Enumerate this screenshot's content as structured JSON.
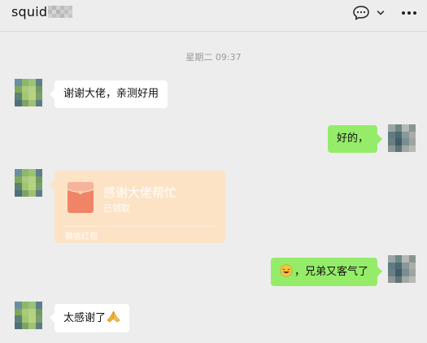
{
  "header": {
    "chat_name": "squid",
    "icons": [
      "chat-bubble-icon",
      "chevron-down-icon",
      "more-icon"
    ]
  },
  "timestamp": "星期二 09:37",
  "messages": [
    {
      "direction": "in",
      "text": "谢谢大佬，亲测好用"
    },
    {
      "direction": "out",
      "text": "好的，"
    },
    {
      "direction": "in",
      "type": "red_packet",
      "title": "感谢大佬帮忙",
      "status": "已领取",
      "footer": "微信红包"
    },
    {
      "direction": "out",
      "emoji": "laughing-tears-emoji",
      "text": "，兄弟又客气了"
    },
    {
      "direction": "in",
      "text": "太感谢了",
      "emoji": "praying-hands-emoji"
    }
  ],
  "colors": {
    "background": "#ededed",
    "incoming_bubble": "#ffffff",
    "outgoing_bubble": "#95ec69",
    "red_packet": "#fde3c6",
    "red_packet_icon": "#f08466"
  }
}
